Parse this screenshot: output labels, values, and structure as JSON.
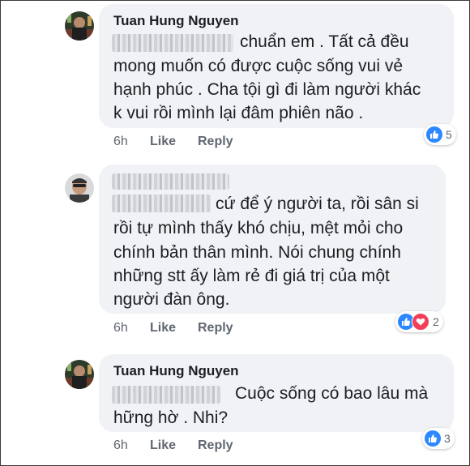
{
  "comments": [
    {
      "author": "Tuan Hung Nguyen",
      "lines": [
        "chuẩn em . Tất cả đều",
        "mong muốn có được cuộc sống vui vẻ",
        "hạnh phúc . Cha tội gì đi làm người khác",
        "k vui rồi mình lại đâm phiên não ."
      ],
      "time": "6h",
      "like_label": "Like",
      "reply_label": "Reply",
      "reactions": [
        "like-icon"
      ],
      "reaction_count": "5"
    },
    {
      "author": "",
      "lines": [
        "cứ để ý người ta, rồi sân si",
        "rồi tự mình thấy khó chịu, mệt mỏi cho",
        "chính bản thân mình. Nói chung chính",
        "những stt ấy làm rẻ đi giá trị của một",
        "người đàn ông."
      ],
      "time": "6h",
      "like_label": "Like",
      "reply_label": "Reply",
      "reactions": [
        "like-icon",
        "love-icon"
      ],
      "reaction_count": "2"
    },
    {
      "author": "Tuan Hung Nguyen",
      "lines": [
        "Cuộc sống có bao lâu mà",
        "hững hờ . Nhi?"
      ],
      "time": "6h",
      "like_label": "Like",
      "reply_label": "Reply",
      "reactions": [
        "like-icon"
      ],
      "reaction_count": "3"
    }
  ],
  "colors": {
    "bubble": "#f0f2f5",
    "like": "#2d88ff",
    "love": "#f33e58",
    "meta": "#606770"
  }
}
